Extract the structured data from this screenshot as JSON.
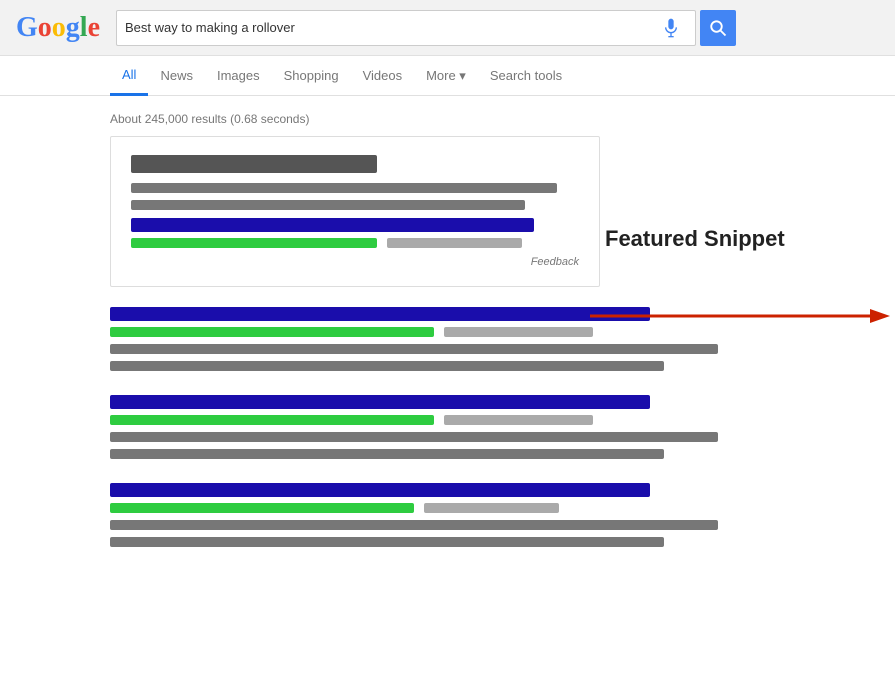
{
  "header": {
    "logo_letters": [
      "G",
      "o",
      "o",
      "g",
      "l",
      "e"
    ],
    "search_query": "Best way to making a rollover",
    "mic_label": "mic-icon",
    "search_button_label": "search-button"
  },
  "nav": {
    "items": [
      {
        "label": "All",
        "active": true
      },
      {
        "label": "News",
        "active": false
      },
      {
        "label": "Images",
        "active": false
      },
      {
        "label": "Shopping",
        "active": false
      },
      {
        "label": "Videos",
        "active": false
      },
      {
        "label": "More ▾",
        "active": false
      },
      {
        "label": "Search tools",
        "active": false
      }
    ]
  },
  "results": {
    "count_text": "About 245,000 results (0.68 seconds)",
    "feedback_label": "Feedback",
    "featured_snippet_label": "Featured Snippet"
  },
  "colors": {
    "blue": "#1a0dab",
    "green": "#2ecc40",
    "gray_dark": "#555",
    "gray_medium": "#777",
    "gray_light": "#aaa",
    "arrow_red": "#cc2200"
  }
}
